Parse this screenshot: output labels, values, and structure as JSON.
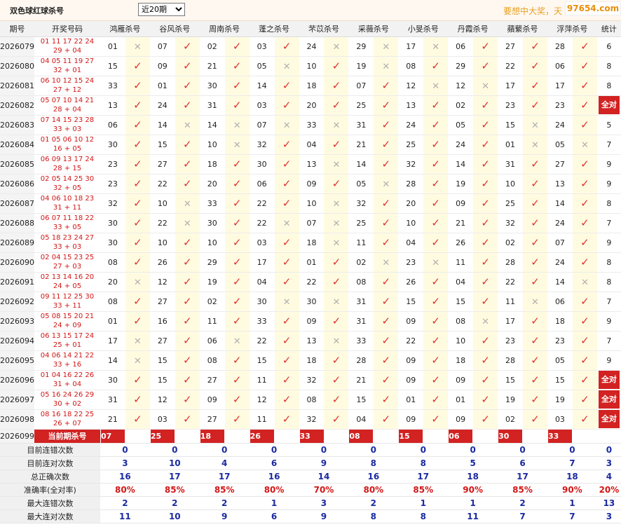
{
  "header": {
    "title": "双色球红球杀号",
    "select_value": "近20期",
    "slogan": "要想中大奖，天",
    "site": "97654.com"
  },
  "columns": {
    "period": "期号",
    "draw": "开奖号码",
    "experts": [
      "鸿雁杀号",
      "谷风杀号",
      "周南杀号",
      "蓬之杀号",
      "芣苡杀号",
      "采薇杀号",
      "小旻杀号",
      "丹霞杀号",
      "蘋蘩杀号",
      "浮萍杀号"
    ],
    "count": "统计"
  },
  "rows": [
    {
      "period": "2026079",
      "draw1": "01 11 17 22 24",
      "draw2": "29 + 04",
      "picks": [
        "01",
        "07",
        "02",
        "03",
        "24",
        "29",
        "17",
        "06",
        "27",
        "28"
      ],
      "marks": [
        0,
        1,
        1,
        1,
        0,
        0,
        0,
        1,
        1,
        1
      ],
      "count": "6"
    },
    {
      "period": "2026080",
      "draw1": "04 05 11 19 27",
      "draw2": "32 + 01",
      "picks": [
        "15",
        "09",
        "21",
        "05",
        "10",
        "19",
        "08",
        "29",
        "22",
        "06"
      ],
      "marks": [
        1,
        1,
        1,
        0,
        1,
        0,
        1,
        1,
        1,
        1
      ],
      "count": "8"
    },
    {
      "period": "2026081",
      "draw1": "06 10 12 15 24",
      "draw2": "27 + 12",
      "picks": [
        "33",
        "01",
        "30",
        "14",
        "18",
        "07",
        "12",
        "12",
        "17",
        "17"
      ],
      "marks": [
        1,
        1,
        1,
        1,
        1,
        1,
        0,
        0,
        1,
        1
      ],
      "count": "8"
    },
    {
      "period": "2026082",
      "draw1": "05 07 10 14 21",
      "draw2": "28 + 04",
      "picks": [
        "13",
        "24",
        "31",
        "03",
        "20",
        "25",
        "13",
        "02",
        "23",
        "23"
      ],
      "marks": [
        1,
        1,
        1,
        1,
        1,
        1,
        1,
        1,
        1,
        1
      ],
      "count": "全对"
    },
    {
      "period": "2026083",
      "draw1": "07 14 15 23 28",
      "draw2": "33 + 03",
      "picks": [
        "06",
        "14",
        "14",
        "07",
        "33",
        "31",
        "24",
        "05",
        "15",
        "24"
      ],
      "marks": [
        1,
        0,
        0,
        0,
        0,
        1,
        1,
        1,
        0,
        1
      ],
      "count": "5"
    },
    {
      "period": "2026084",
      "draw1": "01 05 06 10 12",
      "draw2": "16 + 05",
      "picks": [
        "30",
        "15",
        "10",
        "32",
        "04",
        "21",
        "25",
        "24",
        "01",
        "05"
      ],
      "marks": [
        1,
        1,
        0,
        1,
        1,
        1,
        1,
        1,
        0,
        0
      ],
      "count": "7"
    },
    {
      "period": "2026085",
      "draw1": "06 09 13 17 24",
      "draw2": "28 + 15",
      "picks": [
        "23",
        "27",
        "18",
        "30",
        "13",
        "14",
        "32",
        "14",
        "31",
        "27"
      ],
      "marks": [
        1,
        1,
        1,
        1,
        0,
        1,
        1,
        1,
        1,
        1
      ],
      "count": "9"
    },
    {
      "period": "2026086",
      "draw1": "02 05 14 25 30",
      "draw2": "32 + 05",
      "picks": [
        "23",
        "22",
        "20",
        "06",
        "09",
        "05",
        "28",
        "19",
        "10",
        "13"
      ],
      "marks": [
        1,
        1,
        1,
        1,
        1,
        0,
        1,
        1,
        1,
        1
      ],
      "count": "9"
    },
    {
      "period": "2026087",
      "draw1": "04 06 10 18 23",
      "draw2": "31 + 11",
      "picks": [
        "32",
        "10",
        "33",
        "22",
        "10",
        "32",
        "20",
        "09",
        "25",
        "14"
      ],
      "marks": [
        1,
        0,
        1,
        1,
        0,
        1,
        1,
        1,
        1,
        1
      ],
      "count": "8"
    },
    {
      "period": "2026088",
      "draw1": "06 07 11 18 22",
      "draw2": "33 + 05",
      "picks": [
        "30",
        "22",
        "30",
        "22",
        "07",
        "25",
        "10",
        "21",
        "32",
        "24"
      ],
      "marks": [
        1,
        0,
        1,
        0,
        0,
        1,
        1,
        1,
        1,
        1
      ],
      "count": "7"
    },
    {
      "period": "2026089",
      "draw1": "05 18 23 24 27",
      "draw2": "33 + 03",
      "picks": [
        "30",
        "10",
        "10",
        "03",
        "18",
        "11",
        "04",
        "26",
        "02",
        "07"
      ],
      "marks": [
        1,
        1,
        1,
        1,
        0,
        1,
        1,
        1,
        1,
        1
      ],
      "count": "9"
    },
    {
      "period": "2026090",
      "draw1": "02 04 15 23 25",
      "draw2": "27 + 03",
      "picks": [
        "08",
        "26",
        "29",
        "17",
        "01",
        "02",
        "23",
        "11",
        "28",
        "24"
      ],
      "marks": [
        1,
        1,
        1,
        1,
        1,
        0,
        0,
        1,
        1,
        1
      ],
      "count": "8"
    },
    {
      "period": "2026091",
      "draw1": "02 13 14 16 20",
      "draw2": "24 + 05",
      "picks": [
        "20",
        "12",
        "19",
        "04",
        "22",
        "08",
        "26",
        "04",
        "22",
        "14"
      ],
      "marks": [
        0,
        1,
        1,
        1,
        1,
        1,
        1,
        1,
        1,
        0
      ],
      "count": "8"
    },
    {
      "period": "2026092",
      "draw1": "09 11 12 25 30",
      "draw2": "33 + 11",
      "picks": [
        "08",
        "27",
        "02",
        "30",
        "30",
        "31",
        "15",
        "15",
        "11",
        "06"
      ],
      "marks": [
        1,
        1,
        1,
        0,
        0,
        1,
        1,
        1,
        0,
        1
      ],
      "count": "7"
    },
    {
      "period": "2026093",
      "draw1": "05 08 15 20 21",
      "draw2": "24 + 09",
      "picks": [
        "01",
        "16",
        "11",
        "33",
        "09",
        "31",
        "09",
        "08",
        "17",
        "18"
      ],
      "marks": [
        1,
        1,
        1,
        1,
        1,
        1,
        1,
        0,
        1,
        1
      ],
      "count": "9"
    },
    {
      "period": "2026094",
      "draw1": "06 13 15 17 24",
      "draw2": "25 + 01",
      "picks": [
        "17",
        "27",
        "06",
        "22",
        "13",
        "33",
        "22",
        "10",
        "23",
        "23"
      ],
      "marks": [
        0,
        1,
        0,
        1,
        0,
        1,
        1,
        1,
        1,
        1
      ],
      "count": "7"
    },
    {
      "period": "2026095",
      "draw1": "04 06 14 21 22",
      "draw2": "33 + 16",
      "picks": [
        "14",
        "15",
        "08",
        "15",
        "18",
        "28",
        "09",
        "18",
        "28",
        "05"
      ],
      "marks": [
        0,
        1,
        1,
        1,
        1,
        1,
        1,
        1,
        1,
        1
      ],
      "count": "9"
    },
    {
      "period": "2026096",
      "draw1": "01 04 16 22 26",
      "draw2": "31 + 04",
      "picks": [
        "30",
        "15",
        "27",
        "11",
        "32",
        "21",
        "09",
        "09",
        "15",
        "15"
      ],
      "marks": [
        1,
        1,
        1,
        1,
        1,
        1,
        1,
        1,
        1,
        1
      ],
      "count": "全对"
    },
    {
      "period": "2026097",
      "draw1": "05 16 24 26 29",
      "draw2": "30 + 02",
      "picks": [
        "31",
        "12",
        "09",
        "12",
        "08",
        "15",
        "01",
        "01",
        "19",
        "19"
      ],
      "marks": [
        1,
        1,
        1,
        1,
        1,
        1,
        1,
        1,
        1,
        1
      ],
      "count": "全对"
    },
    {
      "period": "2026098",
      "draw1": "08 16 18 22 25",
      "draw2": "26 + 07",
      "picks": [
        "21",
        "03",
        "27",
        "11",
        "32",
        "04",
        "09",
        "09",
        "02",
        "03"
      ],
      "marks": [
        1,
        1,
        1,
        1,
        1,
        1,
        1,
        1,
        1,
        1
      ],
      "count": "全对"
    }
  ],
  "current": {
    "period": "2026099",
    "label": "当前期杀号",
    "picks": [
      "07",
      "25",
      "18",
      "26",
      "33",
      "08",
      "15",
      "06",
      "30",
      "33"
    ]
  },
  "stats": [
    {
      "label": "目前连错次数",
      "values": [
        "0",
        "0",
        "0",
        "0",
        "0",
        "0",
        "0",
        "0",
        "0",
        "0"
      ],
      "total": "0"
    },
    {
      "label": "目前连对次数",
      "values": [
        "3",
        "10",
        "4",
        "6",
        "9",
        "8",
        "8",
        "5",
        "6",
        "7"
      ],
      "total": "3"
    },
    {
      "label": "总正确次数",
      "values": [
        "16",
        "17",
        "17",
        "16",
        "14",
        "16",
        "17",
        "18",
        "17",
        "18"
      ],
      "total": "4"
    },
    {
      "label": "准确率(全对率)",
      "values": [
        "80%",
        "85%",
        "85%",
        "80%",
        "70%",
        "80%",
        "85%",
        "90%",
        "85%",
        "90%"
      ],
      "total": "20%",
      "pct": true
    },
    {
      "label": "最大连错次数",
      "values": [
        "2",
        "2",
        "2",
        "1",
        "3",
        "2",
        "1",
        "1",
        "2",
        "1"
      ],
      "total": "13"
    },
    {
      "label": "最大连对次数",
      "values": [
        "11",
        "10",
        "9",
        "6",
        "9",
        "8",
        "8",
        "11",
        "7",
        "7"
      ],
      "total": "3"
    }
  ],
  "colors": {
    "red": "#d22222",
    "check": "#e03030",
    "cross": "#b0b0b0",
    "highlight": "#fffbe0",
    "stat_blue": "#1a2aa0"
  }
}
